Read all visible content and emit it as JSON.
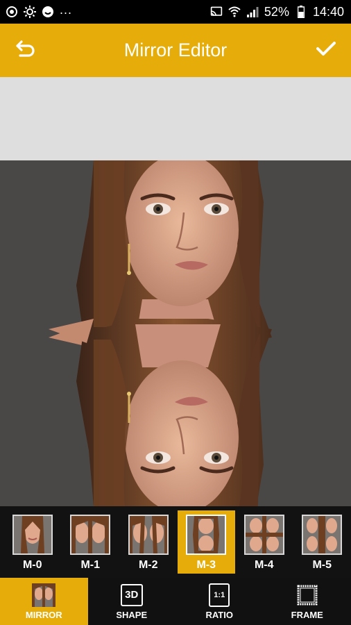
{
  "status_bar": {
    "icons_left": [
      "record-icon",
      "brightness-icon",
      "smiley-icon"
    ],
    "dots": "...",
    "icons_right": [
      "cast-icon",
      "wifi-icon",
      "signal-icon"
    ],
    "battery_percent": "52%",
    "time": "14:40"
  },
  "app_bar": {
    "title": "Mirror Editor",
    "back_icon": "undo-icon",
    "done_icon": "check-icon",
    "background": "#e6ad0a"
  },
  "thumbnails": [
    {
      "label": "M-0",
      "selected": false
    },
    {
      "label": "M-1",
      "selected": false
    },
    {
      "label": "M-2",
      "selected": false
    },
    {
      "label": "M-3",
      "selected": true
    },
    {
      "label": "M-4",
      "selected": false
    },
    {
      "label": "M-5",
      "selected": false
    }
  ],
  "bottom_nav": [
    {
      "label": "MIRROR",
      "icon": "mirror-thumbnail-icon",
      "active": true
    },
    {
      "label": "SHAPE",
      "icon": "3d-icon",
      "icon_text": "3D",
      "active": false
    },
    {
      "label": "RATIO",
      "icon": "ratio-icon",
      "icon_text": "1:1",
      "active": false
    },
    {
      "label": "FRAME",
      "icon": "frame-icon",
      "active": false
    }
  ],
  "colors": {
    "accent": "#e6ad0a",
    "strip_bg": "#121212",
    "canvas_bg": "#4a4847"
  }
}
